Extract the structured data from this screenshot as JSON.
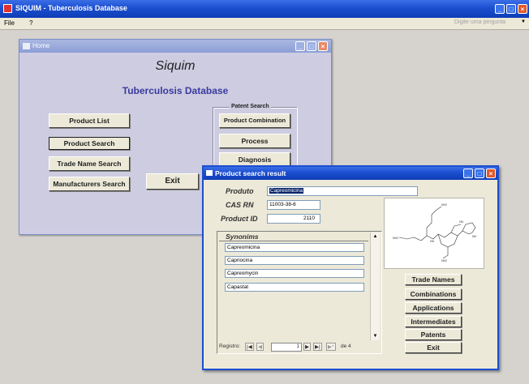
{
  "app": {
    "title": "SIQUIM - Tuberculosis Database",
    "menu": [
      "File",
      "?"
    ],
    "help_placeholder": "Digite uma pergunta"
  },
  "home": {
    "title": "Home",
    "heading": "Siquim",
    "subheading": "Tuberculosis Database",
    "buttons": [
      "Product List",
      "Product Search",
      "Trade Name Search",
      "Manufacturers Search"
    ],
    "exit_label": "Exit",
    "patent_group_label": "Patent Search",
    "patent_buttons": [
      "Product Combination",
      "Process",
      "Diagnosis"
    ]
  },
  "result": {
    "title": "Product search result",
    "produto_label": "Produto",
    "produto_value": "Capreomicina",
    "casrn_label": "CAS RN",
    "casrn_value": "11003-38-6",
    "productid_label": "Product ID",
    "productid_value": "2110",
    "synonyms_header": "Synonims",
    "synonyms": [
      "Capreomicina",
      "Capriocina",
      "Capreomycin",
      "Capastat"
    ],
    "nav": {
      "label": "Registro:",
      "current": "1",
      "total_text": "de 4"
    },
    "side_buttons": [
      "Trade Names",
      "Combinations",
      "Applications",
      "Intermediates",
      "Patents",
      "Exit"
    ]
  }
}
